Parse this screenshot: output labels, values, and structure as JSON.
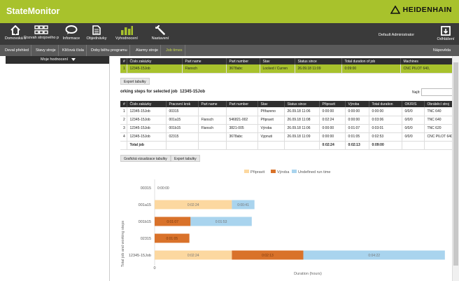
{
  "app": {
    "title": "StateMonitor",
    "brand": "HEIDENHAIN"
  },
  "nav": {
    "items": [
      {
        "label": "Domovská s",
        "icon": "home-icon"
      },
      {
        "label": "Rozvah strojového p",
        "icon": "grid-icon"
      },
      {
        "label": "Informace",
        "icon": "chat-icon"
      },
      {
        "label": "Objednávky",
        "icon": "document-icon"
      },
      {
        "label": "Vyhodnocení",
        "icon": "bar-chart-icon"
      },
      {
        "label": "Nastavení",
        "icon": "wrench-icon"
      }
    ],
    "user": "Default Administrator",
    "logout": "Odhlášení"
  },
  "subnav": {
    "tabs": [
      "Deval přehled",
      "Stavy stroje",
      "Klíčová čísla",
      "Doby běhu programu",
      "Alarmy stroje",
      "Job times"
    ],
    "active_index": 5,
    "help": "Nápověda"
  },
  "sidebar": {
    "header": "Moje hodnocení"
  },
  "jobs": {
    "columns": [
      "#",
      "Číslo zakázky",
      "Part name",
      "Part number",
      "Stav",
      "Status since",
      "Total duration of job",
      "Machines"
    ],
    "rows": [
      [
        "1",
        "12345-15Job",
        "Flansch",
        "3678abc",
        "Locked / Curren",
        "26.09.18 11:09",
        "0:09:00",
        "CNC PILOT 640,"
      ]
    ],
    "export_label": "Export tabulky"
  },
  "steps": {
    "title": "orking steps for selected job",
    "job": "12345-15Job",
    "find_label": "Najít:",
    "columns": [
      "#",
      "Číslo zakázky",
      "Pracovní krok",
      "Part name",
      "Part number",
      "Stav",
      "Status since",
      "Připravit",
      "Výroba",
      "Total duration",
      "OK/R/S",
      "Obráběcí stroj"
    ],
    "rows": [
      [
        "1",
        "12345-15Job",
        "00315",
        "",
        "",
        "Přiřazeno",
        "26.09.18 11:06",
        "0:00:00",
        "0:00:00",
        "0:00:00",
        "0/0/0",
        "TNC 640"
      ],
      [
        "2",
        "12345-15Job",
        "001a15",
        "Flansch",
        "546821-002",
        "Připravit",
        "26.09.18 11:08",
        "0:02:24",
        "0:00:00",
        "0:03:06",
        "0/0/0",
        "TNC 640"
      ],
      [
        "3",
        "12345-15Job",
        "001b15",
        "Flansch",
        "3821-005",
        "Výroba",
        "26.09.18 11:06",
        "0:00:00",
        "0:01:07",
        "0:03:01",
        "0/0/0",
        "TNC 620"
      ],
      [
        "4",
        "12345-15Job",
        "02315",
        "",
        "3678abc",
        "Vypnuti",
        "26.09.18 11:09",
        "0:00:00",
        "0:01:05",
        "0:02:53",
        "0/0/0",
        "CNC PILOT 640"
      ]
    ],
    "total": [
      "",
      "Total job",
      "",
      "",
      "",
      "",
      "",
      "0:02:24",
      "0:02:13",
      "0:09:00",
      "",
      ""
    ],
    "graph_button": "Grafická vizualizace tabulky",
    "export_label": "Export tabulky"
  },
  "chart_data": {
    "type": "bar",
    "orientation": "horizontal",
    "stacked": true,
    "ylabel": "Total job and working steps",
    "xlabel": "Duration (hours)",
    "categories": [
      "00315",
      "001a15",
      "001b15",
      "02315",
      "12345-15Job"
    ],
    "series": [
      {
        "name": "Připravit",
        "color": "#fcd8a0",
        "values": [
          0,
          0.04,
          0,
          0,
          0.04
        ],
        "labels": [
          "0:00:00",
          "0:02:24",
          "",
          "",
          "0:02:24"
        ]
      },
      {
        "name": "Výroba",
        "color": "#d9722a",
        "values": [
          0,
          0,
          0.0186,
          0.018,
          0.037
        ],
        "labels": [
          "",
          "",
          "0:01:07",
          "0:01:05",
          "0:02:13"
        ]
      },
      {
        "name": "Undefined run time",
        "color": "#a9d4ee",
        "values": [
          0,
          0.0117,
          0.0317,
          0,
          0.0733
        ],
        "labels": [
          "",
          "0:00:41",
          "0:01:53",
          "",
          "0:04:22"
        ]
      }
    ],
    "xtick_labels": [
      "0"
    ],
    "xlim": [
      0,
      0.15
    ],
    "legend": "top"
  }
}
